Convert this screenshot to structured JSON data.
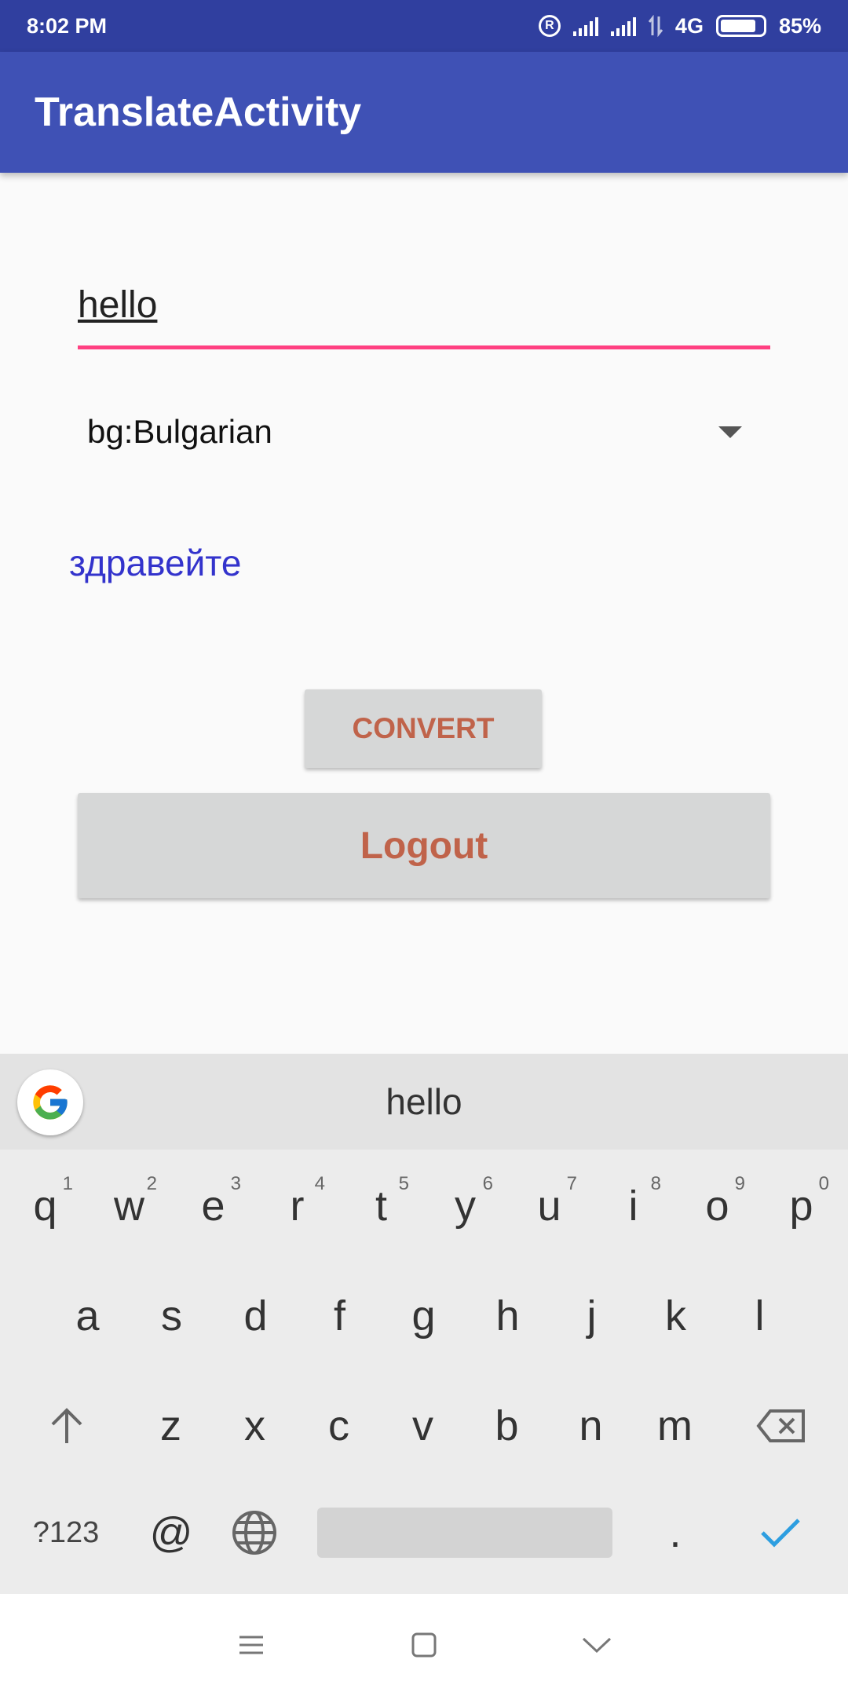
{
  "status_bar": {
    "time": "8:02 PM",
    "network_type": "4G",
    "battery_percent": "85%",
    "battery_level": 0.85,
    "icons": [
      "registered-icon",
      "signal-icon",
      "signal-icon",
      "data-arrows-icon",
      "battery-icon"
    ]
  },
  "app_bar": {
    "title": "TranslateActivity"
  },
  "form": {
    "input_value": "hello",
    "language_selected": "bg:Bulgarian",
    "translation_result": "здравейте",
    "convert_label": "CONVERT",
    "logout_label": "Logout"
  },
  "keyboard": {
    "suggestion": "hello",
    "row1": [
      {
        "key": "q",
        "hint": "1"
      },
      {
        "key": "w",
        "hint": "2"
      },
      {
        "key": "e",
        "hint": "3"
      },
      {
        "key": "r",
        "hint": "4"
      },
      {
        "key": "t",
        "hint": "5"
      },
      {
        "key": "y",
        "hint": "6"
      },
      {
        "key": "u",
        "hint": "7"
      },
      {
        "key": "i",
        "hint": "8"
      },
      {
        "key": "o",
        "hint": "9"
      },
      {
        "key": "p",
        "hint": "0"
      }
    ],
    "row2": [
      "a",
      "s",
      "d",
      "f",
      "g",
      "h",
      "j",
      "k",
      "l"
    ],
    "row3": [
      "z",
      "x",
      "c",
      "v",
      "b",
      "n",
      "m"
    ],
    "symbols_label": "?123",
    "at_label": "@",
    "period_label": "."
  },
  "nav_bar": {
    "icons": [
      "menu-icon",
      "home-square-icon",
      "back-chevron-icon"
    ]
  },
  "colors": {
    "status_bar": "#303f9f",
    "app_bar": "#3f51b5",
    "accent": "#ff4081",
    "result_text": "#3333cc",
    "button_text": "#c0634a",
    "button_bg": "#d6d7d7"
  }
}
